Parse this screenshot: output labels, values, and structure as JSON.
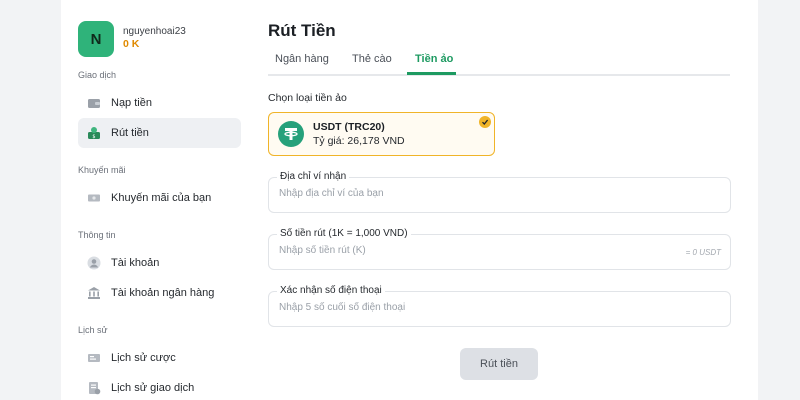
{
  "user": {
    "avatar_letter": "N",
    "username": "nguyenhoai23",
    "balance": "0 K"
  },
  "sidebar": {
    "sections": [
      {
        "title": "Giao dịch"
      },
      {
        "title": "Khuyến mãi"
      },
      {
        "title": "Thông tin"
      },
      {
        "title": "Lịch sử"
      }
    ],
    "items": [
      {
        "label": "Nạp tiền",
        "icon": "wallet-icon"
      },
      {
        "label": "Rút tiền",
        "icon": "withdraw-icon",
        "active": true
      },
      {
        "label": "Khuyến mãi của bạn",
        "icon": "ticket-icon"
      },
      {
        "label": "Tài khoản",
        "icon": "user-icon"
      },
      {
        "label": "Tài khoản ngân hàng",
        "icon": "bank-icon"
      },
      {
        "label": "Lịch sử cược",
        "icon": "bet-history-icon"
      },
      {
        "label": "Lịch sử giao dịch",
        "icon": "transaction-history-icon"
      }
    ]
  },
  "main": {
    "title": "Rút Tiền",
    "tabs": [
      {
        "label": "Ngân hàng"
      },
      {
        "label": "Thẻ cào"
      },
      {
        "label": "Tiền ảo",
        "active": true
      }
    ],
    "coin_section_label": "Chọn loại tiền ảo",
    "coin": {
      "name": "USDT (TRC20)",
      "rate": "Tỷ giá: 26,178 VND",
      "selected": true
    },
    "fields": {
      "address": {
        "label": "Địa chỉ ví nhận",
        "placeholder": "Nhập địa chỉ ví của bạn",
        "value": ""
      },
      "amount": {
        "label": "Số tiền rút (1K = 1,000 VND)",
        "placeholder": "Nhập số tiền rút (K)",
        "value": "",
        "suffix": "= 0 USDT"
      },
      "phone": {
        "label": "Xác nhận số điện thoại",
        "placeholder": "Nhập 5 số cuối số điện thoại",
        "value": ""
      }
    },
    "submit_label": "Rút tiền"
  },
  "colors": {
    "accent": "#1d9a61",
    "avatar": "#2fb37a",
    "balance": "#e08a00",
    "coin_border": "#f0b429",
    "tether": "#26a17b"
  }
}
